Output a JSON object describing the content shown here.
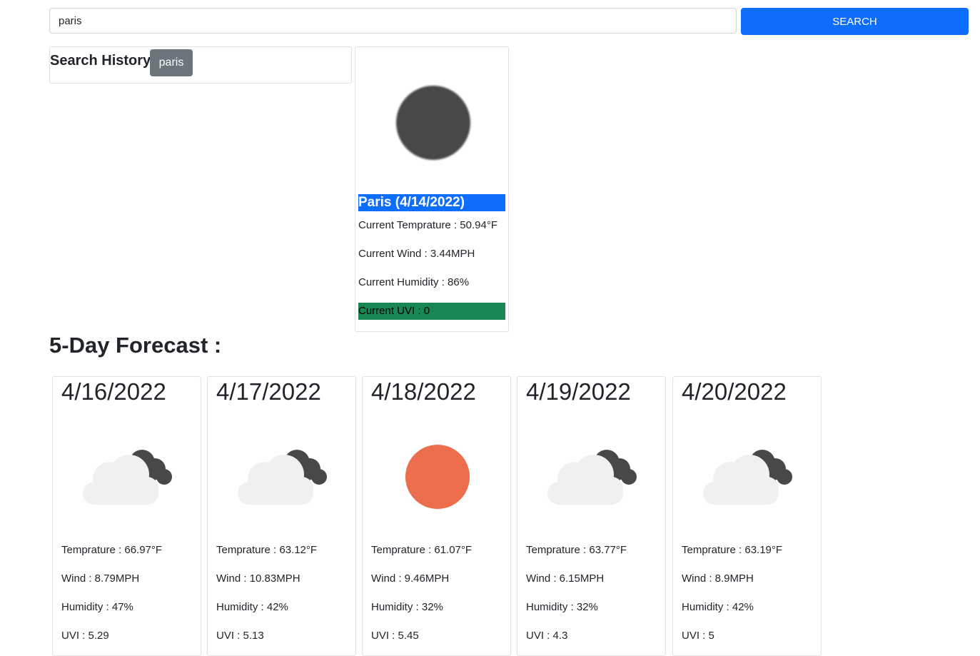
{
  "search": {
    "value": "paris",
    "button_label": "SEARCH"
  },
  "history": {
    "label": "Search History:",
    "items": [
      "paris"
    ]
  },
  "current": {
    "title": "Paris (4/14/2022)",
    "icon": "dark-circle-icon",
    "temperature": "Current Temprature : 50.94°F",
    "wind": "Current Wind : 3.44MPH",
    "humidity": "Current Humidity : 86%",
    "uvi": "Current UVI : 0",
    "uvi_color": "#198754"
  },
  "forecast": {
    "heading": "5-Day Forecast :",
    "days": [
      {
        "date": "4/16/2022",
        "icon": "partly-cloudy-icon",
        "temperature": "Temprature : 66.97°F",
        "wind": "Wind : 8.79MPH",
        "humidity": "Humidity : 47%",
        "uvi": "UVI : 5.29"
      },
      {
        "date": "4/17/2022",
        "icon": "partly-cloudy-icon",
        "temperature": "Temprature : 63.12°F",
        "wind": "Wind : 10.83MPH",
        "humidity": "Humidity : 42%",
        "uvi": "UVI : 5.13"
      },
      {
        "date": "4/18/2022",
        "icon": "sun-icon",
        "temperature": "Temprature : 61.07°F",
        "wind": "Wind : 9.46MPH",
        "humidity": "Humidity : 32%",
        "uvi": "UVI : 5.45"
      },
      {
        "date": "4/19/2022",
        "icon": "partly-cloudy-icon",
        "temperature": "Temprature : 63.77°F",
        "wind": "Wind : 6.15MPH",
        "humidity": "Humidity : 32%",
        "uvi": "UVI : 4.3"
      },
      {
        "date": "4/20/2022",
        "icon": "partly-cloudy-icon",
        "temperature": "Temprature : 63.19°F",
        "wind": "Wind : 8.9MPH",
        "humidity": "Humidity : 42%",
        "uvi": "UVI : 5"
      }
    ]
  },
  "colors": {
    "primary": "#0d6efd",
    "secondary": "#6c757d",
    "success": "#198754",
    "sun": "#ed6e4c",
    "cloud_light": "#f0f0f0",
    "cloud_dark": "#48484a"
  }
}
